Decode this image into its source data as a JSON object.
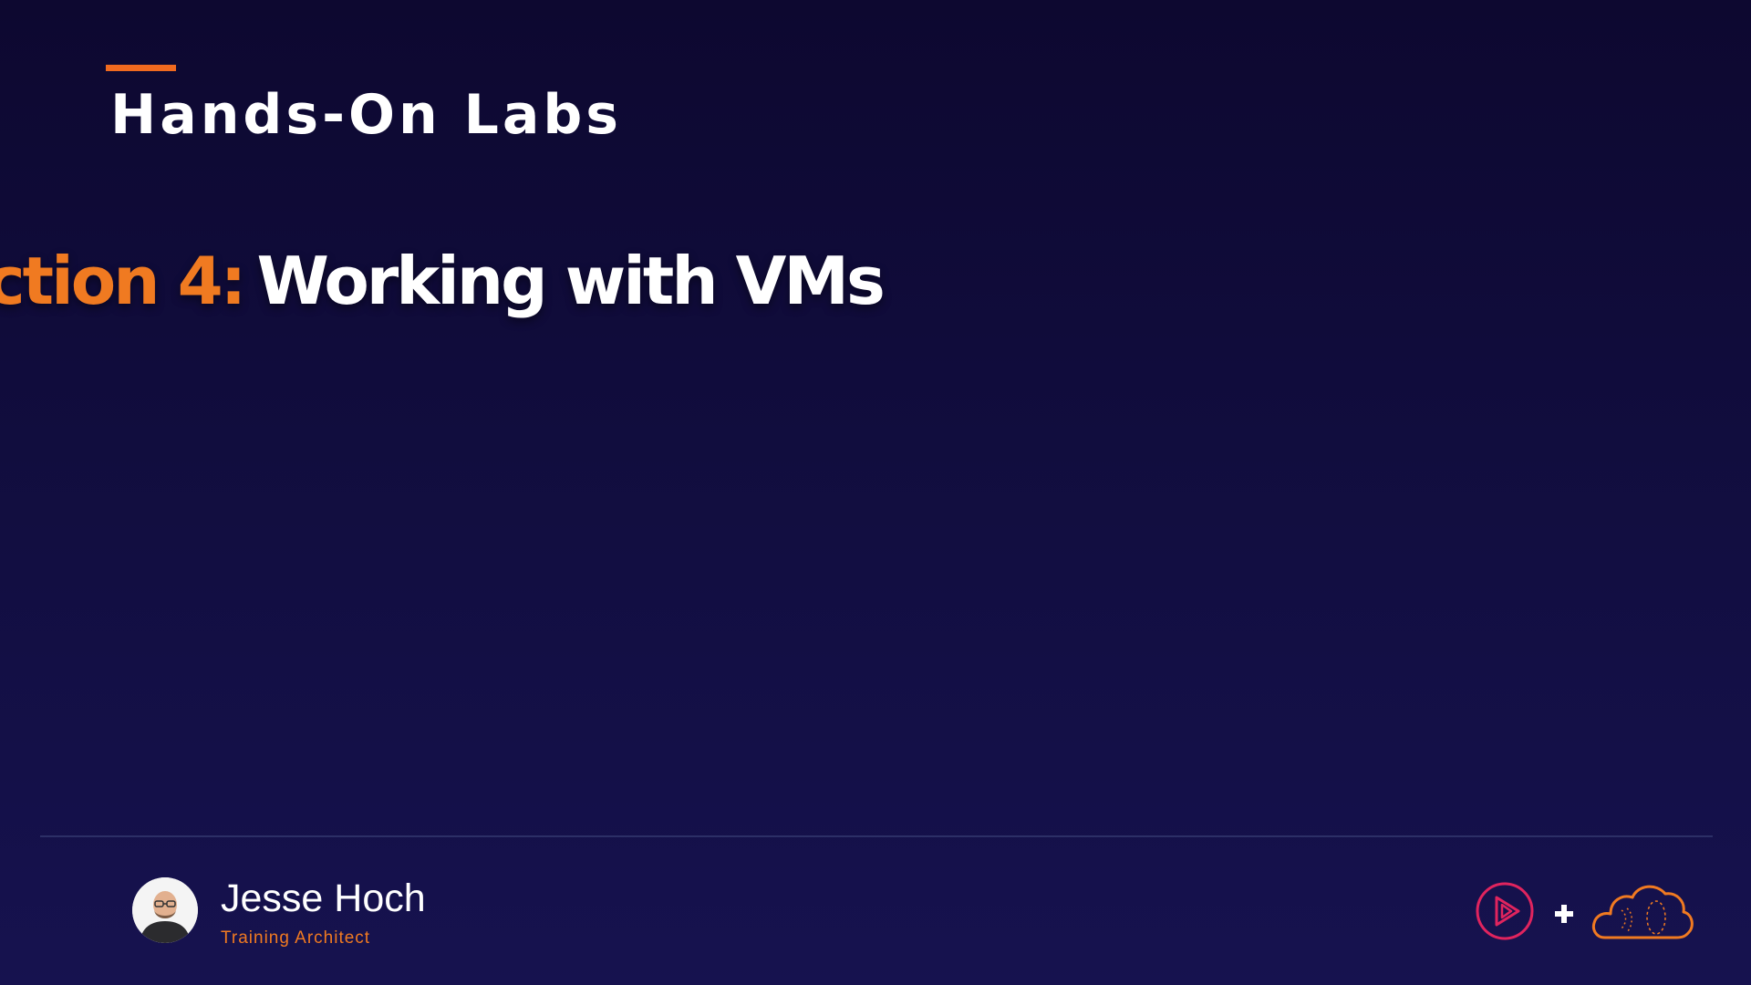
{
  "header": {
    "title": "Hands-On Labs"
  },
  "section": {
    "prefix": "ction 4:",
    "title": "Working with VMs"
  },
  "presenter": {
    "name": "Jesse Hoch",
    "role": "Training Architect"
  },
  "colors": {
    "background": "#110d3e",
    "accent": "#f06a1f",
    "text": "#ffffff",
    "play_logo": "#e0245e"
  },
  "icons": {
    "avatar": "presenter-photo",
    "play_logo": "play-icon",
    "plus": "plus-icon",
    "cloud_logo": "cloud-icon"
  }
}
